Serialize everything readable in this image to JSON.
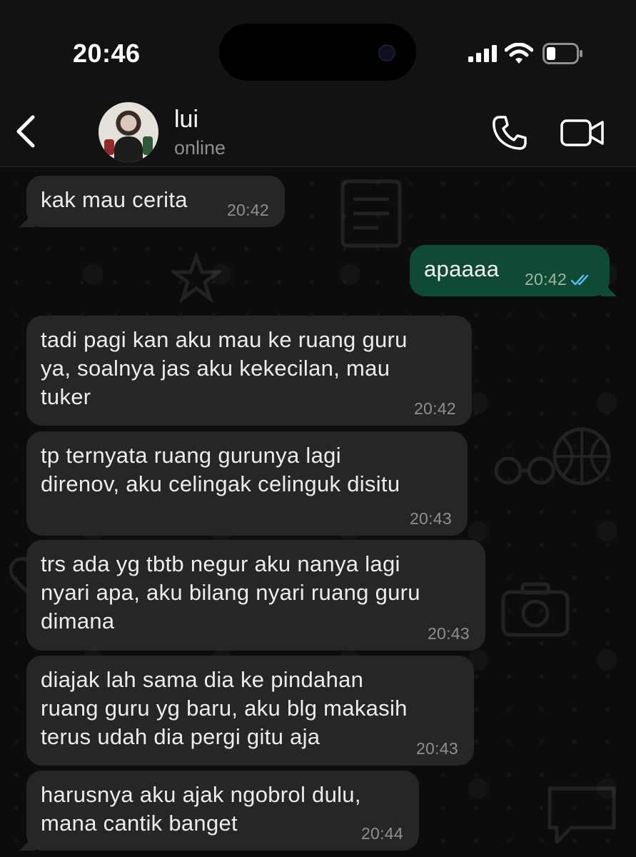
{
  "status_bar": {
    "time": "20:46",
    "icons": [
      "signal-icon",
      "wifi-icon",
      "battery-icon"
    ],
    "battery_level": 0.3
  },
  "header": {
    "contact_name": "lui",
    "contact_status": "online",
    "icons": [
      "back-icon",
      "avatar",
      "phone-icon",
      "video-call-icon"
    ]
  },
  "colors": {
    "incoming_bubble": "#262626",
    "outgoing_bubble": "#0f4a34",
    "read_receipt": "#53bdeb",
    "background": "#0c0c0c"
  },
  "messages": [
    {
      "direction": "incoming",
      "text": "kak mau cerita",
      "time": "20:42"
    },
    {
      "direction": "outgoing",
      "text": "apaaaa",
      "time": "20:42",
      "status": "read"
    },
    {
      "direction": "incoming",
      "text": "tadi pagi kan aku mau ke ruang guru\nya, soalnya jas aku kekecilan, mau\ntuker",
      "time": "20:42"
    },
    {
      "direction": "incoming",
      "text": "tp ternyata ruang gurunya lagi\ndirenov, aku celingak celinguk disitu",
      "time": "20:43"
    },
    {
      "direction": "incoming",
      "text": "trs ada yg tbtb negur aku nanya lagi\nnyari apa, aku bilang nyari ruang guru\ndimana",
      "time": "20:43"
    },
    {
      "direction": "incoming",
      "text": "diajak lah sama dia ke pindahan\nruang guru yg baru, aku blg makasih\nterus udah dia pergi gitu aja",
      "time": "20:43"
    },
    {
      "direction": "incoming",
      "text": "harusnya aku ajak ngobrol dulu,\nmana cantik banget",
      "time": "20:44"
    }
  ]
}
